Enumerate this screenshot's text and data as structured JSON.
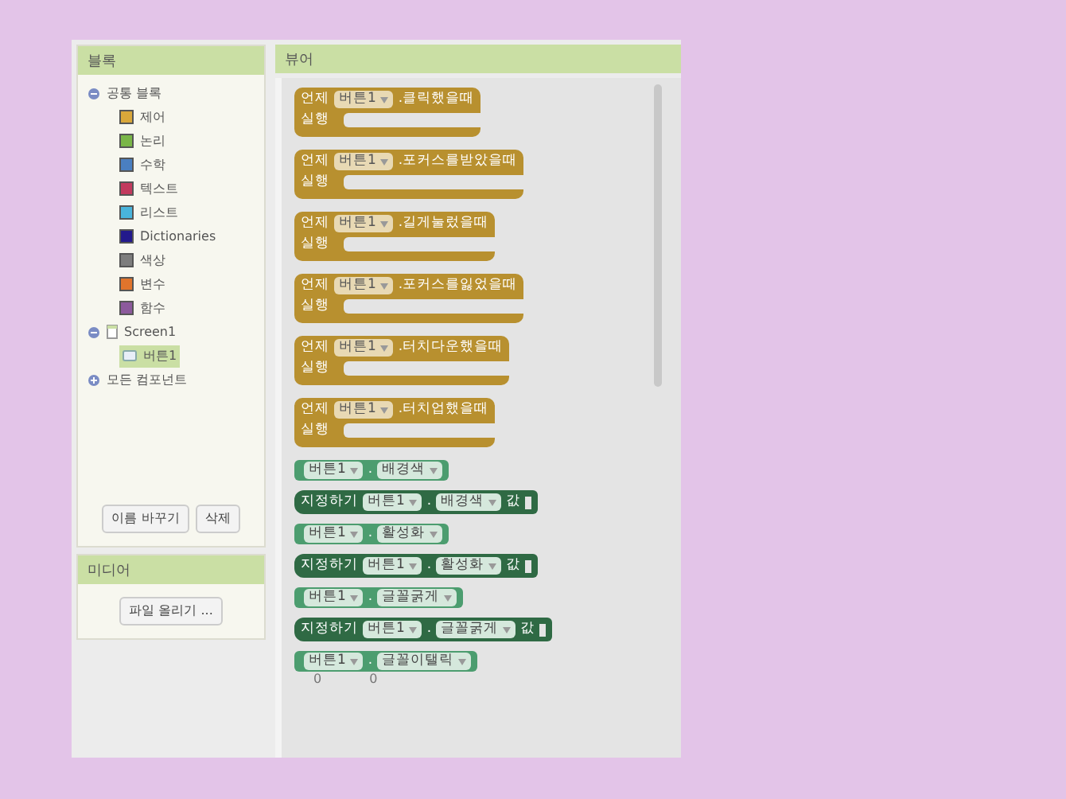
{
  "blocks_panel": {
    "title": "블록",
    "tree": [
      {
        "label": "공통 블록",
        "expanded": true,
        "children": [
          {
            "label": "제어",
            "color": "#d9a73a"
          },
          {
            "label": "논리",
            "color": "#7ab648"
          },
          {
            "label": "수학",
            "color": "#4a7fc1"
          },
          {
            "label": "텍스트",
            "color": "#c23a5e"
          },
          {
            "label": "리스트",
            "color": "#49b4dc"
          },
          {
            "label": "Dictionaries",
            "color": "#231a8c"
          },
          {
            "label": "색상",
            "color": "#7d7d7d"
          },
          {
            "label": "변수",
            "color": "#e0742c"
          },
          {
            "label": "함수",
            "color": "#8c5a9c"
          }
        ]
      },
      {
        "label": "Screen1",
        "expanded": true,
        "children": [
          {
            "label": "버튼1",
            "selected": true
          }
        ]
      },
      {
        "label": "모든 컴포넌트",
        "expanded": false
      }
    ],
    "buttons": [
      "이름 바꾸기",
      "삭제"
    ]
  },
  "media_panel": {
    "title": "미디어",
    "button": "파일 올리기 ..."
  },
  "viewer": {
    "title": "뷰어",
    "warnings": [
      "0",
      "0"
    ],
    "blocks": [
      {
        "kind": "event",
        "prefix": "언제",
        "component": "버튼1",
        "event": ".클릭했을때",
        "do": "실행"
      },
      {
        "kind": "event",
        "prefix": "언제",
        "component": "버튼1",
        "event": ".포커스를받았을때",
        "do": "실행"
      },
      {
        "kind": "event",
        "prefix": "언제",
        "component": "버튼1",
        "event": ".길게눌렀을때",
        "do": "실행"
      },
      {
        "kind": "event",
        "prefix": "언제",
        "component": "버튼1",
        "event": ".포커스를잃었을때",
        "do": "실행"
      },
      {
        "kind": "event",
        "prefix": "언제",
        "component": "버튼1",
        "event": ".터치다운했을때",
        "do": "실행"
      },
      {
        "kind": "event",
        "prefix": "언제",
        "component": "버튼1",
        "event": ".터치업했을때",
        "do": "실행"
      },
      {
        "kind": "getter",
        "component": "버튼1",
        "separator": ".",
        "property": "배경색"
      },
      {
        "kind": "setter",
        "prefix": "지정하기",
        "component": "버튼1",
        "separator": ".",
        "property": "배경색",
        "suffix": "값"
      },
      {
        "kind": "getter",
        "component": "버튼1",
        "separator": ".",
        "property": "활성화"
      },
      {
        "kind": "setter",
        "prefix": "지정하기",
        "component": "버튼1",
        "separator": ".",
        "property": "활성화",
        "suffix": "값"
      },
      {
        "kind": "getter",
        "component": "버튼1",
        "separator": ".",
        "property": "글꼴굵게"
      },
      {
        "kind": "setter",
        "prefix": "지정하기",
        "component": "버튼1",
        "separator": ".",
        "property": "글꼴굵게",
        "suffix": "값"
      },
      {
        "kind": "getter",
        "component": "버튼1",
        "separator": ".",
        "property": "글꼴이탤릭"
      }
    ]
  }
}
